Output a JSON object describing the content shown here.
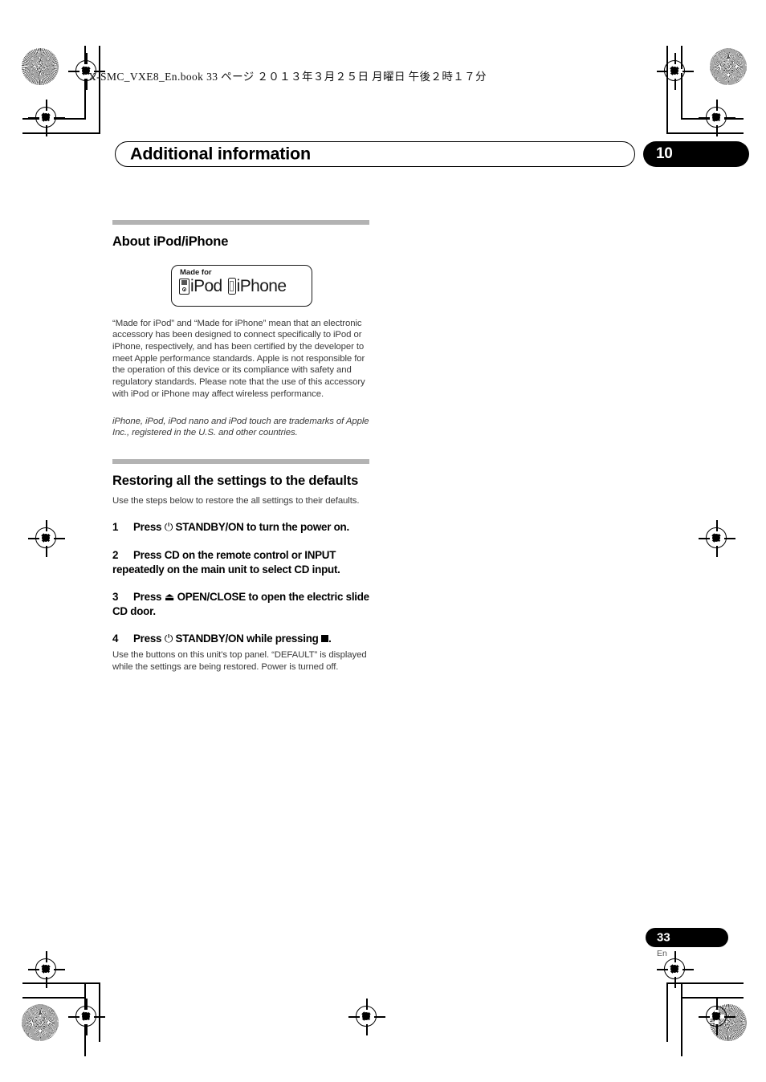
{
  "book_header": "X-SMC_VXE8_En.book   33 ページ   ２０１３年３月２５日   月曜日   午後２時１７分",
  "chapter": {
    "title": "Additional information",
    "number": "10"
  },
  "sections": [
    {
      "heading": "About iPod/iPhone",
      "badge": {
        "made_for_label": "Made for",
        "ipod_word": "iPod",
        "iphone_word": "iPhone"
      },
      "paragraphs": [
        "“Made for iPod” and “Made for iPhone” mean that an electronic accessory has been designed to connect specifically to iPod or iPhone, respectively, and has been certified by the developer to meet Apple performance standards. Apple is not responsible for the operation of this device or its compliance with safety and regulatory standards. Please note that the use of this accessory with iPod or iPhone may affect wireless performance.",
        "iPhone, iPod, iPod nano and iPod touch are trademarks of Apple Inc., registered in the U.S. and other countries."
      ]
    },
    {
      "heading": "Restoring all the settings to the defaults",
      "lead": "Use the steps below to restore the all settings to their defaults.",
      "steps": [
        {
          "number": "1",
          "text_before": "Press",
          "symbol": "⏻",
          "symbol_name": "power-standby-icon",
          "text_after": "STANDBY/ON to turn the power on.",
          "note": ""
        },
        {
          "number": "2",
          "text_before": "",
          "symbol": "",
          "symbol_name": "",
          "text_after": "Press CD on the remote control or INPUT repeatedly on the main unit to select CD input.",
          "note": ""
        },
        {
          "number": "3",
          "text_before": "Press",
          "symbol": "⏏",
          "symbol_name": "eject-icon",
          "text_after": "OPEN/CLOSE to open the electric slide CD door.",
          "note": ""
        },
        {
          "number": "4",
          "text_before": "Press",
          "symbol": "⏻",
          "symbol_name": "power-standby-icon",
          "text_after": "STANDBY/ON while pressing",
          "trailing_symbol": "stop-square",
          "trailing_text": ".",
          "note": "Use the buttons on this unit's top panel. “DEFAULT” is displayed while the settings are being restored. Power is turned off."
        }
      ]
    }
  ],
  "footer": {
    "page_number": "33",
    "language": "En"
  },
  "colors": {
    "rule_gray": "#b3b3b3",
    "body_text": "#3a3a3a",
    "accent_black": "#000000"
  }
}
